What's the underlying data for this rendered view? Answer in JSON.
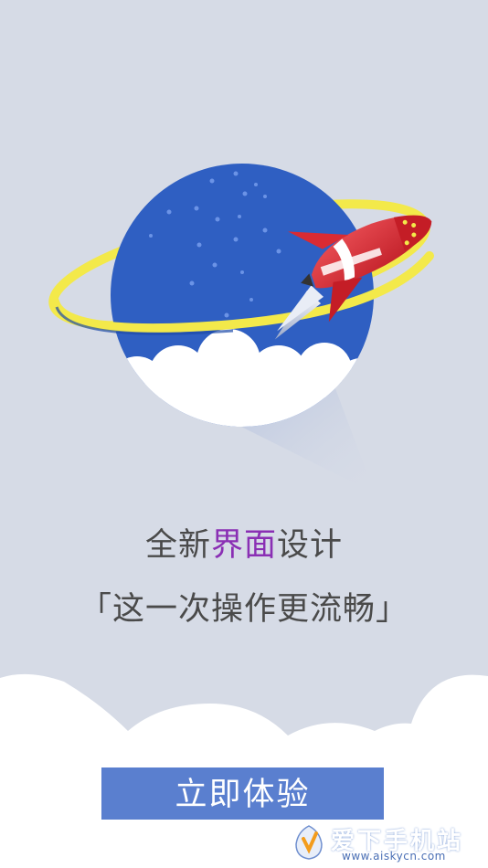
{
  "headline": {
    "before": "全新",
    "accent": "界面",
    "after": "设计"
  },
  "subline": "「这一次操作更流畅」",
  "cta": {
    "label": "立即体验"
  },
  "watermark": {
    "title": "爱下手机站",
    "url": "www.aiskycn.com"
  },
  "colors": {
    "background": "#d6dbe6",
    "planet": "#2f5fc2",
    "ring": "#f3e94a",
    "rocket": "#d92b33",
    "moon": "#f3e94a",
    "button": "#5a7fcf",
    "accent_text": "#8a2fb4"
  }
}
